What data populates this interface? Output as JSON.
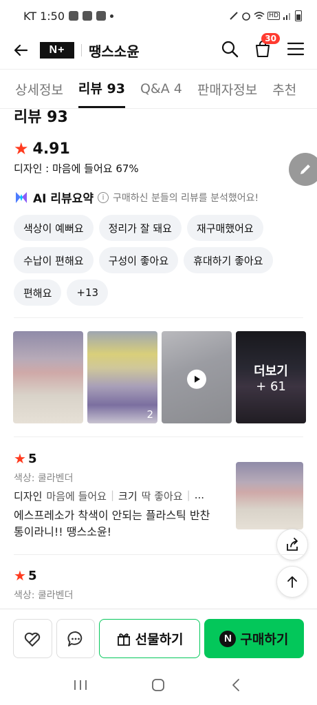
{
  "status_bar": {
    "carrier_time": "KT 1:50",
    "hd": "HD"
  },
  "header": {
    "logo_text": "N+",
    "store_name": "땡스소윤",
    "cart_count": "30"
  },
  "tabs": [
    {
      "label": "상세정보"
    },
    {
      "label": "리뷰 93"
    },
    {
      "label": "Q&A 4"
    },
    {
      "label": "판매자정보"
    },
    {
      "label": "추천"
    }
  ],
  "review_summary": {
    "title": "리뷰 93",
    "rating": "4.91",
    "design_line": "디자인 : 마음에 들어요 67%",
    "ai_title": "AI 리뷰요약",
    "ai_desc": "구매하신 분들의 리뷰를 분석했어요!",
    "chips": [
      "색상이 예뻐요",
      "정리가 잘 돼요",
      "재구매했어요",
      "수납이 편해요",
      "구성이 좋아요",
      "휴대하기 좋아요",
      "편해요",
      "+13"
    ]
  },
  "photos": {
    "second_count": "2",
    "more_label": "더보기",
    "more_count": "+ 61"
  },
  "reviews": [
    {
      "score": "5",
      "option": "색상: 쿨라벤더",
      "tag1_label": "디자인",
      "tag1_value": "마음에 들어요",
      "tag2_label": "크기",
      "tag2_value": "딱 좋아요",
      "more": "...",
      "text": "에스프레소가 착색이 안되는 플라스틱 반찬통이라니!! 땡스소윤!"
    },
    {
      "score": "5",
      "option": "색상: 쿨라벤더"
    }
  ],
  "bottom_bar": {
    "gift_label": "선물하기",
    "buy_label": "구매하기",
    "buy_logo": "N"
  },
  "colors": {
    "accent_green": "#03c75a",
    "star_red": "#ff3b1f",
    "badge_red": "#ff3b30"
  }
}
